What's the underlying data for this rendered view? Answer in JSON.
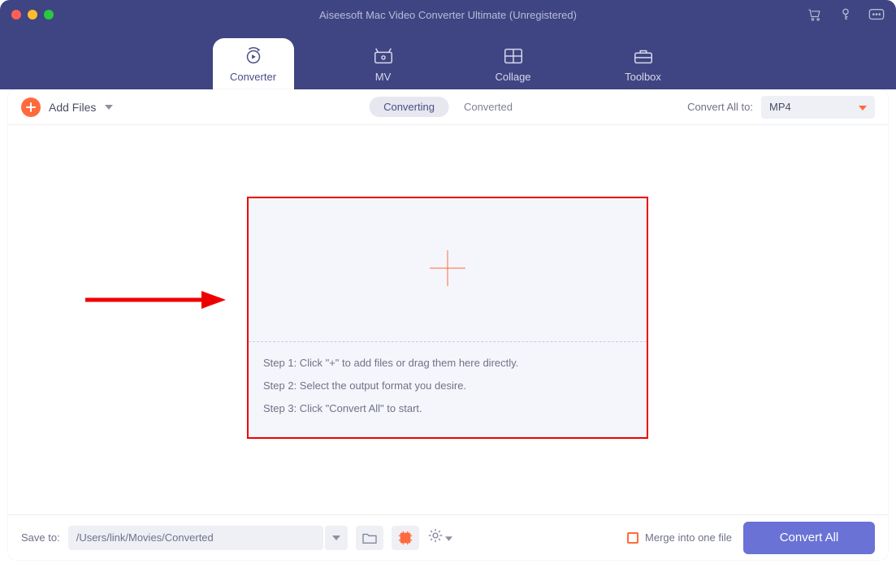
{
  "colors": {
    "accent_orange": "#ff6a3d",
    "primary_purple": "#6a72d6",
    "header_navy": "#3f4582"
  },
  "titlebar": {
    "title": "Aiseesoft Mac Video Converter Ultimate (Unregistered)"
  },
  "nav": {
    "items": [
      {
        "id": "converter",
        "label": "Converter",
        "active": true
      },
      {
        "id": "mv",
        "label": "MV",
        "active": false
      },
      {
        "id": "collage",
        "label": "Collage",
        "active": false
      },
      {
        "id": "toolbox",
        "label": "Toolbox",
        "active": false
      }
    ]
  },
  "toolbar": {
    "add_files_label": "Add Files",
    "segments": {
      "converting": "Converting",
      "converted": "Converted",
      "active": "converting"
    },
    "convert_all_to_label": "Convert All to:",
    "format_selected": "MP4"
  },
  "dropzone": {
    "step1": "Step 1: Click \"+\" to add files or drag them here directly.",
    "step2": "Step 2: Select the output format you desire.",
    "step3": "Step 3: Click \"Convert All\" to start."
  },
  "footer": {
    "save_to_label": "Save to:",
    "save_path": "/Users/link/Movies/Converted",
    "merge_label": "Merge into one file",
    "convert_all_label": "Convert All"
  }
}
